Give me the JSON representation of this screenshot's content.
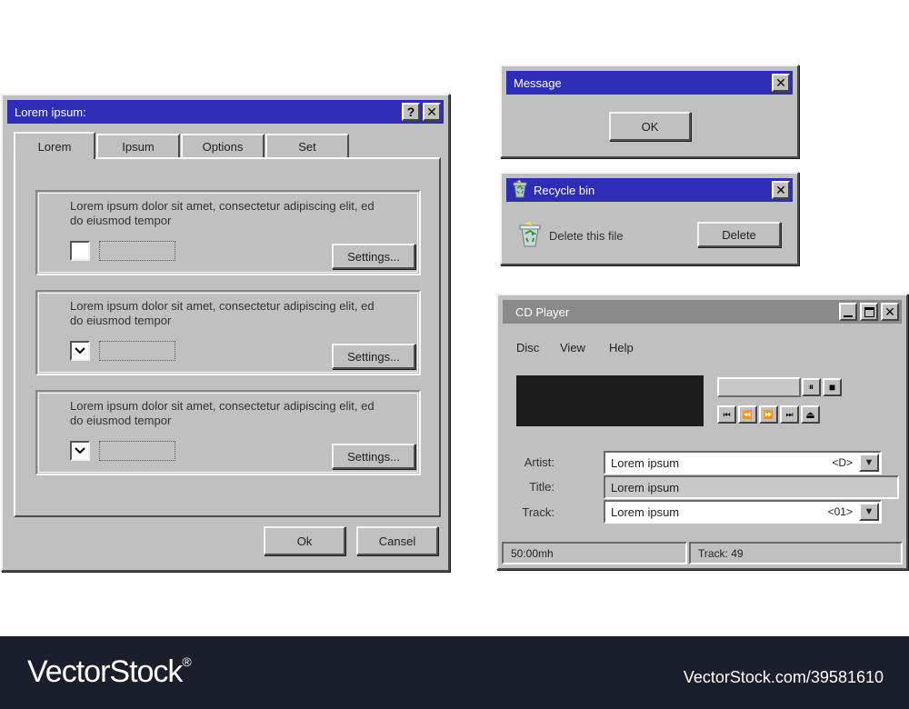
{
  "main_dialog": {
    "title": "Lorem ipsum:",
    "help_label": "?",
    "close_label": "✕",
    "tabs": [
      {
        "label": "Lorem",
        "active": true
      },
      {
        "label": "Ipsum",
        "active": false
      },
      {
        "label": "Options",
        "active": false
      },
      {
        "label": "Set",
        "active": false
      }
    ],
    "groups": [
      {
        "text": "Lorem ipsum dolor sit amet, consectetur adipiscing elit, ed do eiusmod tempor",
        "checked": false,
        "settings_label": "Settings..."
      },
      {
        "text": "Lorem ipsum dolor sit amet, consectetur adipiscing elit, ed do eiusmod tempor",
        "checked": true,
        "settings_label": "Settings..."
      },
      {
        "text": "Lorem ipsum dolor sit amet, consectetur adipiscing elit, ed do eiusmod tempor",
        "checked": true,
        "settings_label": "Settings..."
      }
    ],
    "ok_label": "Ok",
    "cancel_label": "Cansel"
  },
  "message_dialog": {
    "title": "Message",
    "close_label": "✕",
    "ok_label": "OK"
  },
  "recycle_dialog": {
    "title": "Recycle bin",
    "close_label": "✕",
    "text": "Delete this file",
    "delete_label": "Delete"
  },
  "cd_player": {
    "title": "CD Player",
    "menu": [
      "Disc",
      "View",
      "Help"
    ],
    "controls": {
      "pause": "⏸",
      "stop": "■",
      "prev": "⏮",
      "rewind": "⏪",
      "forward": "⏩",
      "next": "⏭",
      "eject": "⏏"
    },
    "fields": {
      "artist_label": "Artist:",
      "artist_value": "Lorem ipsum",
      "artist_tag": "<D>",
      "title_label": "Title:",
      "title_value": "Lorem ipsum",
      "track_label": "Track:",
      "track_value": "Lorem ipsum",
      "track_tag": "<01>"
    },
    "status": {
      "time": "50:00mh",
      "track": "Track: 49"
    }
  },
  "footer": {
    "brand": "VectorStock",
    "registered": "®",
    "url": "VectorStock.com/39581610"
  },
  "colors": {
    "window_gray": "#c0c0c0",
    "titlebar_blue": "#2d2db7",
    "footer_bg": "#1b1f2b"
  }
}
